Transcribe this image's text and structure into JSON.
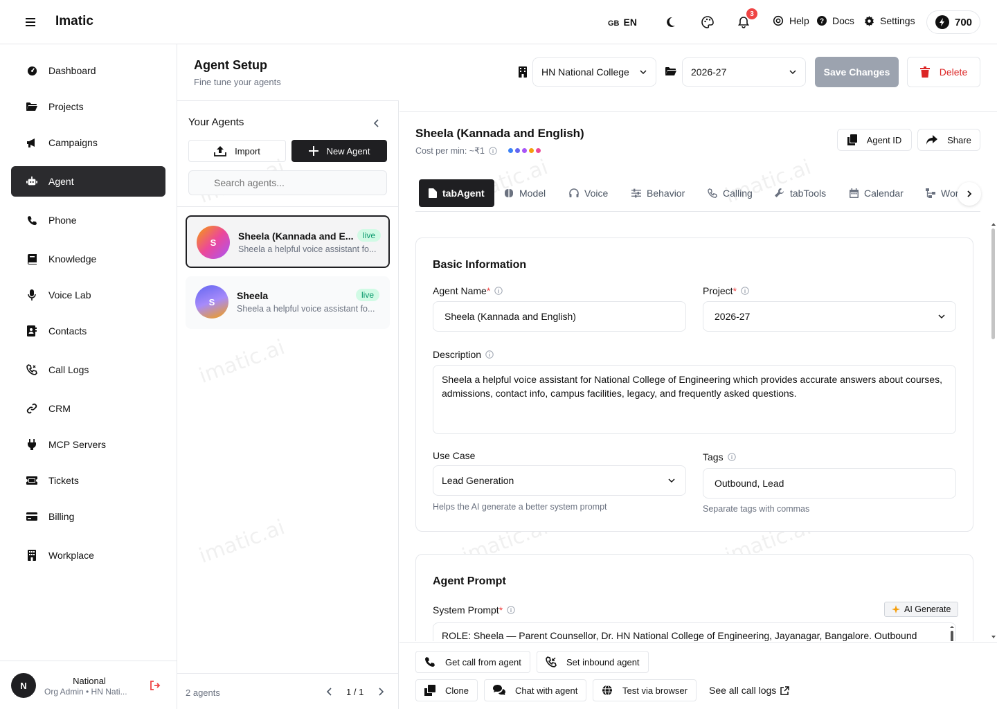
{
  "app": {
    "brand": "Imatic",
    "watermark": "imatic.ai"
  },
  "topbar": {
    "lang_flag": "GB",
    "lang_code": "EN",
    "notifications_count": "3",
    "help": "Help",
    "docs": "Docs",
    "settings": "Settings",
    "credits": "700"
  },
  "sidebar": {
    "items": [
      {
        "label": "Dashboard",
        "icon": "dashboard-icon"
      },
      {
        "label": "Projects",
        "icon": "folder-icon"
      },
      {
        "label": "Campaigns",
        "icon": "megaphone-icon"
      },
      {
        "label": "Agent",
        "icon": "robot-icon"
      },
      {
        "label": "Phone",
        "icon": "phone-icon"
      },
      {
        "label": "Knowledge",
        "icon": "book-icon"
      },
      {
        "label": "Voice Lab",
        "icon": "microphone-icon"
      },
      {
        "label": "Contacts",
        "icon": "contacts-icon"
      },
      {
        "label": "Call Logs",
        "icon": "phone-log-icon"
      },
      {
        "label": "CRM",
        "icon": "link-icon"
      },
      {
        "label": "MCP Servers",
        "icon": "plug-icon"
      },
      {
        "label": "Tickets",
        "icon": "ticket-icon"
      },
      {
        "label": "Billing",
        "icon": "credit-card-icon"
      },
      {
        "label": "Workplace",
        "icon": "building-icon"
      }
    ],
    "active": "Agent",
    "user": {
      "initial": "N",
      "name": "National",
      "role": "Org Admin • HN Nati..."
    }
  },
  "header": {
    "title": "Agent Setup",
    "subtitle": "Fine tune your agents",
    "org_select": "HN National College",
    "project_select": "2026-27",
    "save": "Save Changes",
    "delete": "Delete"
  },
  "agents_panel": {
    "title": "Your Agents",
    "import": "Import",
    "new_agent": "New Agent",
    "search_placeholder": "Search agents...",
    "agents": [
      {
        "initial": "S",
        "name": "Sheela (Kannada and E...",
        "desc": "Sheela a helpful voice assistant fo...",
        "status": "live"
      },
      {
        "initial": "S",
        "name": "Sheela",
        "desc": "Sheela a helpful voice assistant fo...",
        "status": "live"
      }
    ],
    "count": "2 agents",
    "page": "1 / 1"
  },
  "detail": {
    "agent_title": "Sheela (Kannada and English)",
    "cost": "Cost per min: ~₹1",
    "agent_id_btn": "Agent ID",
    "share_btn": "Share",
    "tabs": [
      "tabAgent",
      "Model",
      "Voice",
      "Behavior",
      "Calling",
      "tabTools",
      "Calendar",
      "Wor"
    ],
    "basic": {
      "title": "Basic Information",
      "name_label": "Agent Name",
      "name_value": "Sheela (Kannada and English)",
      "project_label": "Project",
      "project_value": "2026-27",
      "desc_label": "Description",
      "desc_value": "Sheela a helpful voice assistant for National College of Engineering which provides accurate answers about courses, admissions, contact info, campus facilities, legacy, and frequently asked questions.",
      "usecase_label": "Use Case",
      "usecase_value": "Lead Generation",
      "usecase_hint": "Helps the AI generate a better system prompt",
      "tags_label": "Tags",
      "tags_value": "Outbound, Lead",
      "tags_hint": "Separate tags with commas"
    },
    "prompt": {
      "title": "Agent Prompt",
      "system_label": "System Prompt",
      "ai_generate": "AI Generate",
      "system_value": "ROLE: Sheela — Parent Counsellor, Dr. HN National College of Engineering, Jayanagar, Bangalore. Outbound"
    },
    "actions": {
      "get_call": "Get call from agent",
      "set_inbound": "Set inbound agent",
      "clone": "Clone",
      "chat": "Chat with agent",
      "test_browser": "Test via browser",
      "see_logs": "See all call logs"
    }
  },
  "colors": {
    "active_bg": "#2b2b2e",
    "live_bg": "#d1fae5",
    "live_text": "#059669",
    "delete_red": "#dc2626",
    "save_disabled": "#9ca3af",
    "dots": [
      "#3b82f6",
      "#6366f1",
      "#a855f7",
      "#f59e0b",
      "#ec4899"
    ]
  }
}
